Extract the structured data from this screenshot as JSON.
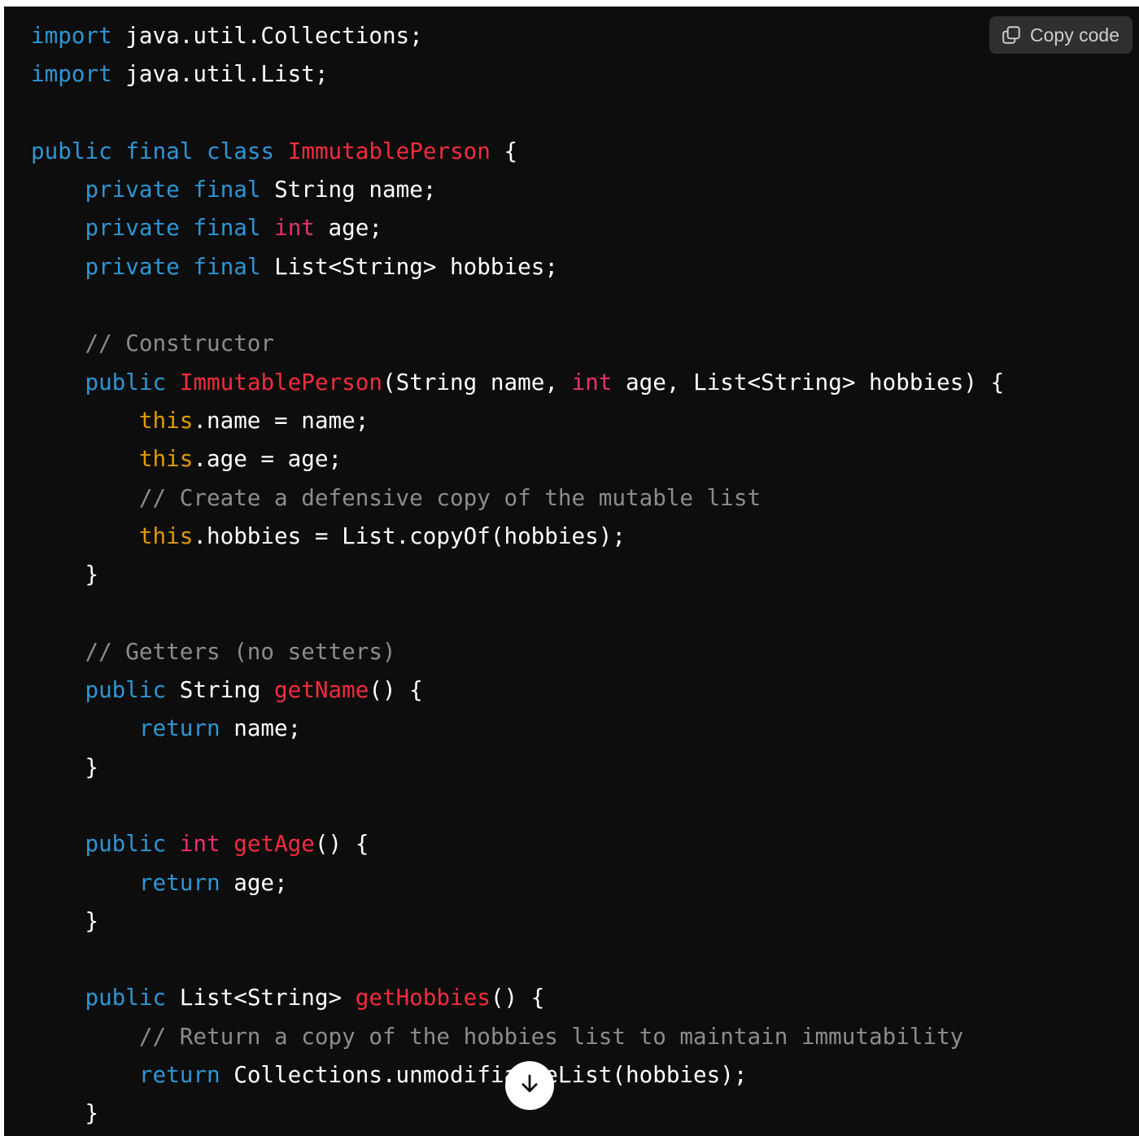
{
  "copy_button": {
    "label": "Copy code",
    "icon": "copy-icon"
  },
  "scroll_button": {
    "icon": "arrow-down-icon"
  },
  "code": {
    "language": "java",
    "lines": [
      [
        [
          "kw",
          "import"
        ],
        [
          "t",
          " java.util.Collections;"
        ]
      ],
      [
        [
          "kw",
          "import"
        ],
        [
          "t",
          " java.util.List;"
        ]
      ],
      [],
      [
        [
          "kw",
          "public"
        ],
        [
          "t",
          " "
        ],
        [
          "kw",
          "final"
        ],
        [
          "t",
          " "
        ],
        [
          "kw",
          "class"
        ],
        [
          "t",
          " "
        ],
        [
          "typ",
          "ImmutablePerson"
        ],
        [
          "t",
          " {"
        ]
      ],
      [
        [
          "t",
          "    "
        ],
        [
          "kw",
          "private"
        ],
        [
          "t",
          " "
        ],
        [
          "kw",
          "final"
        ],
        [
          "t",
          " String name;"
        ]
      ],
      [
        [
          "t",
          "    "
        ],
        [
          "kw",
          "private"
        ],
        [
          "t",
          " "
        ],
        [
          "kw",
          "final"
        ],
        [
          "t",
          " "
        ],
        [
          "prim",
          "int"
        ],
        [
          "t",
          " age;"
        ]
      ],
      [
        [
          "t",
          "    "
        ],
        [
          "kw",
          "private"
        ],
        [
          "t",
          " "
        ],
        [
          "kw",
          "final"
        ],
        [
          "t",
          " List<String> hobbies;"
        ]
      ],
      [],
      [
        [
          "t",
          "    "
        ],
        [
          "com",
          "// Constructor"
        ]
      ],
      [
        [
          "t",
          "    "
        ],
        [
          "kw",
          "public"
        ],
        [
          "t",
          " "
        ],
        [
          "typ",
          "ImmutablePerson"
        ],
        [
          "t",
          "(String name, "
        ],
        [
          "prim",
          "int"
        ],
        [
          "t",
          " age, List<String> hobbies) {"
        ]
      ],
      [
        [
          "t",
          "        "
        ],
        [
          "this",
          "this"
        ],
        [
          "t",
          ".name = name;"
        ]
      ],
      [
        [
          "t",
          "        "
        ],
        [
          "this",
          "this"
        ],
        [
          "t",
          ".age = age;"
        ]
      ],
      [
        [
          "t",
          "        "
        ],
        [
          "com",
          "// Create a defensive copy of the mutable list"
        ]
      ],
      [
        [
          "t",
          "        "
        ],
        [
          "this",
          "this"
        ],
        [
          "t",
          ".hobbies = List.copyOf(hobbies);"
        ]
      ],
      [
        [
          "t",
          "    }"
        ]
      ],
      [],
      [
        [
          "t",
          "    "
        ],
        [
          "com",
          "// Getters (no setters)"
        ]
      ],
      [
        [
          "t",
          "    "
        ],
        [
          "kw",
          "public"
        ],
        [
          "t",
          " String "
        ],
        [
          "typ",
          "getName"
        ],
        [
          "t",
          "() {"
        ]
      ],
      [
        [
          "t",
          "        "
        ],
        [
          "kw",
          "return"
        ],
        [
          "t",
          " name;"
        ]
      ],
      [
        [
          "t",
          "    }"
        ]
      ],
      [],
      [
        [
          "t",
          "    "
        ],
        [
          "kw",
          "public"
        ],
        [
          "t",
          " "
        ],
        [
          "prim",
          "int"
        ],
        [
          "t",
          " "
        ],
        [
          "typ",
          "getAge"
        ],
        [
          "t",
          "() {"
        ]
      ],
      [
        [
          "t",
          "        "
        ],
        [
          "kw",
          "return"
        ],
        [
          "t",
          " age;"
        ]
      ],
      [
        [
          "t",
          "    }"
        ]
      ],
      [],
      [
        [
          "t",
          "    "
        ],
        [
          "kw",
          "public"
        ],
        [
          "t",
          " List<String> "
        ],
        [
          "typ",
          "getHobbies"
        ],
        [
          "t",
          "() {"
        ]
      ],
      [
        [
          "t",
          "        "
        ],
        [
          "com",
          "// Return a copy of the hobbies list to maintain immutability"
        ]
      ],
      [
        [
          "t",
          "        "
        ],
        [
          "kw",
          "return"
        ],
        [
          "t",
          " Collections.unmodifiableList(hobbies);"
        ]
      ],
      [
        [
          "t",
          "    }"
        ]
      ]
    ]
  },
  "colors": {
    "background": "#0d0d0d",
    "keyword": "#2e95d3",
    "type_name": "#f22c3d",
    "primitive": "#e9306d",
    "this_keyword": "#df9a00",
    "comment": "#8c8c8c",
    "text": "#ffffff"
  }
}
